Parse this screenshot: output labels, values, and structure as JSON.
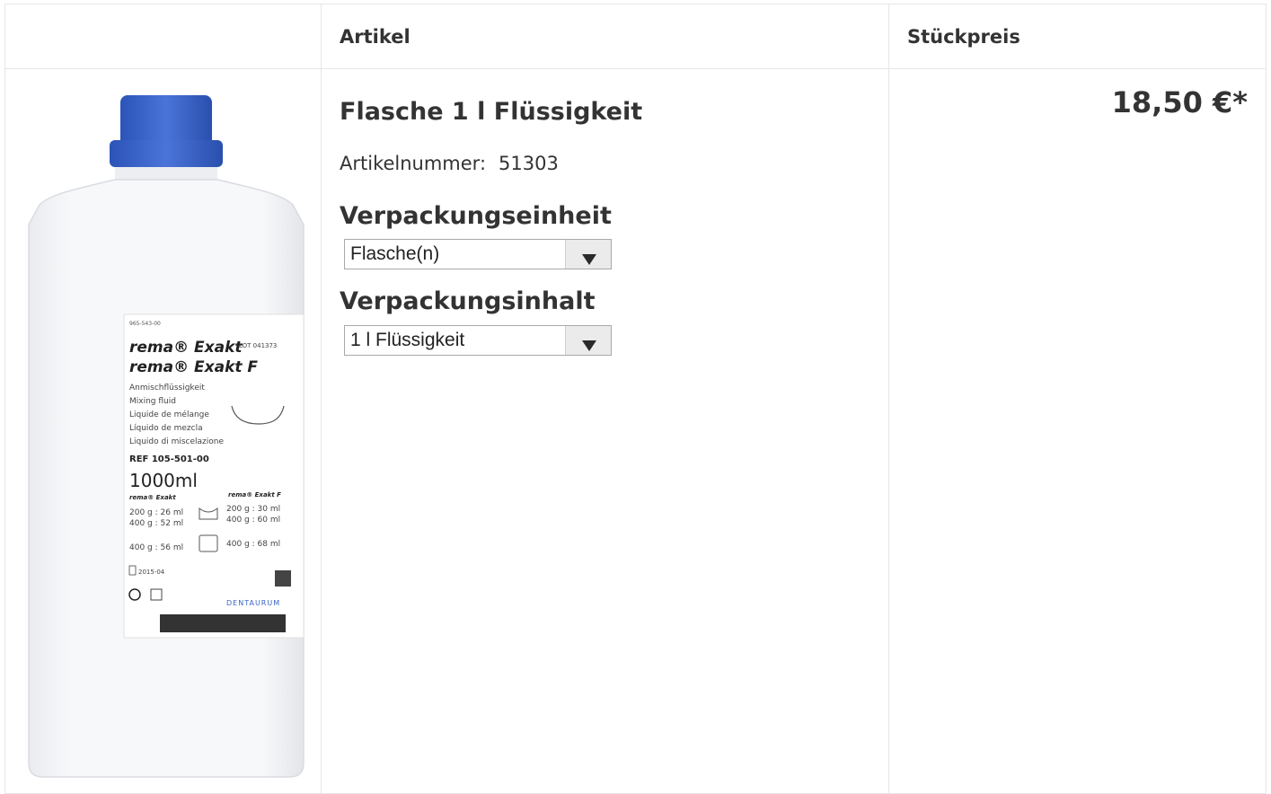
{
  "table": {
    "header": {
      "col_image": "",
      "col_article": "Artikel",
      "col_price": "Stückpreis"
    }
  },
  "product": {
    "title": "Flasche 1 l Flüssigkeit",
    "sku_label": "Artikelnummer:",
    "sku_value": "51303",
    "price": "18,50 €*",
    "image_label": {
      "code": "965-543-00",
      "line1": "rema® Exakt",
      "line2": "rema® Exakt F",
      "lot": "LOT 041373",
      "desc": [
        "Anmischflüssigkeit",
        "Mixing fluid",
        "Liquide de mélange",
        "Líquido de mezcla",
        "Liquido di miscelazione"
      ],
      "ref": "REF 105-501-00",
      "volume": "1000ml",
      "left_head": "rema® Exakt",
      "right_head": "rema® Exakt F",
      "left_1": "200 g : 26 ml",
      "left_2": "400 g : 52 ml",
      "right_1": "200 g : 30 ml",
      "right_2": "400 g : 60 ml",
      "left_3": "400 g : 56 ml",
      "right_3": "400 g : 68 ml",
      "date": "2015-04",
      "brand": "DENTAURUM"
    }
  },
  "options": {
    "packaging_unit": {
      "label": "Verpackungseinheit",
      "selected": "Flasche(n)"
    },
    "packaging_content": {
      "label": "Verpackungsinhalt",
      "selected": "1 l Flüssigkeit"
    }
  },
  "colors": {
    "cap": "#3a64c8",
    "bottle": "#f4f5f7",
    "border": "#e6e6e6",
    "text": "#333333"
  }
}
